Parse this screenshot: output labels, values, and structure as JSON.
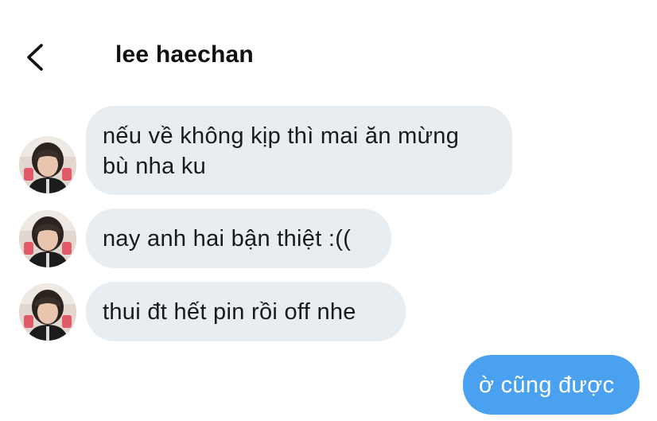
{
  "header": {
    "contact_name": "lee haechan",
    "back_icon": "chevron-left-icon"
  },
  "messages": [
    {
      "direction": "received",
      "text": "nếu về không kịp thì mai ăn mừng bù nha ku",
      "avatar_icon": "avatar-photo"
    },
    {
      "direction": "received",
      "text": "nay anh hai bận thiệt :((",
      "avatar_icon": "avatar-photo"
    },
    {
      "direction": "received",
      "text": "thui đt hết pin rồi off nhe",
      "avatar_icon": "avatar-photo"
    },
    {
      "direction": "sent",
      "text": "ờ cũng được"
    }
  ],
  "colors": {
    "received_bubble": "#e8edf2",
    "sent_bubble": "#4aa1f0",
    "background": "#ffffff"
  }
}
